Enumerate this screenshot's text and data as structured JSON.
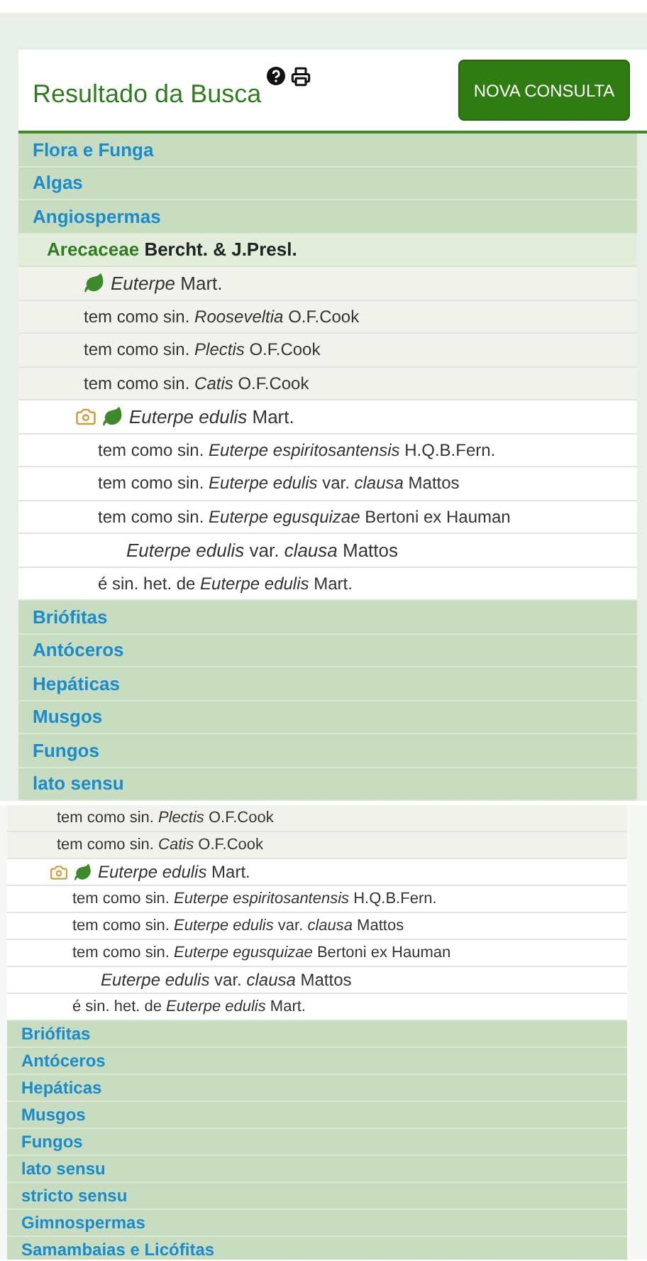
{
  "header": {
    "title": "Resultado da Busca",
    "button": "NOVA CONSULTA"
  },
  "panels": [
    {
      "rows": [
        {
          "kind": "group",
          "text": "Flora e Funga"
        },
        {
          "kind": "group",
          "text": "Algas"
        },
        {
          "kind": "group",
          "text": "Angiospermas"
        },
        {
          "kind": "family",
          "name": "Arecaceae",
          "author": "Bercht. & J.Presl."
        },
        {
          "kind": "genus",
          "text": "*Euterpe* Mart."
        },
        {
          "kind": "genus-synonym",
          "text": "tem como sin. *Rooseveltia* O.F.Cook"
        },
        {
          "kind": "genus-synonym",
          "text": "tem como sin. *Plectis* O.F.Cook"
        },
        {
          "kind": "genus-synonym",
          "text": "tem como sin. *Catis* O.F.Cook"
        },
        {
          "kind": "species",
          "text": "*Euterpe edulis* Mart."
        },
        {
          "kind": "species-synonym",
          "text": "tem como sin. *Euterpe espiritosantensis* H.Q.B.Fern."
        },
        {
          "kind": "species-synonym",
          "text": "tem como sin. *Euterpe edulis* var. *clausa* Mattos"
        },
        {
          "kind": "species-synonym",
          "text": "tem como sin. *Euterpe egusquizae* Bertoni ex Hauman"
        },
        {
          "kind": "variety",
          "text": "*Euterpe edulis* var. *clausa* Mattos"
        },
        {
          "kind": "heterotypic",
          "text": "é sin. het. de *Euterpe edulis* Mart."
        },
        {
          "kind": "group",
          "text": "Briófitas"
        },
        {
          "kind": "group",
          "text": "Antóceros"
        },
        {
          "kind": "group",
          "text": "Hepáticas"
        },
        {
          "kind": "group",
          "text": "Musgos"
        },
        {
          "kind": "group",
          "text": "Fungos"
        },
        {
          "kind": "group",
          "text": "lato sensu"
        }
      ]
    },
    {
      "rows": [
        {
          "kind": "genus-synonym",
          "text": "tem como sin. *Plectis* O.F.Cook"
        },
        {
          "kind": "genus-synonym",
          "text": "tem como sin. *Catis* O.F.Cook"
        },
        {
          "kind": "species",
          "text": "*Euterpe edulis* Mart."
        },
        {
          "kind": "species-synonym",
          "text": "tem como sin. *Euterpe espiritosantensis* H.Q.B.Fern."
        },
        {
          "kind": "species-synonym",
          "text": "tem como sin. *Euterpe edulis* var. *clausa* Mattos"
        },
        {
          "kind": "species-synonym",
          "text": "tem como sin. *Euterpe egusquizae* Bertoni ex Hauman"
        },
        {
          "kind": "variety",
          "text": "*Euterpe edulis* var. *clausa* Mattos"
        },
        {
          "kind": "heterotypic",
          "text": "é sin. het. de *Euterpe edulis* Mart."
        },
        {
          "kind": "group",
          "text": "Briófitas"
        },
        {
          "kind": "group",
          "text": "Antóceros"
        },
        {
          "kind": "group",
          "text": "Hepáticas"
        },
        {
          "kind": "group",
          "text": "Musgos"
        },
        {
          "kind": "group",
          "text": "Fungos"
        },
        {
          "kind": "group",
          "text": "lato sensu"
        },
        {
          "kind": "group",
          "text": "stricto sensu"
        },
        {
          "kind": "group",
          "text": "Gimnospermas"
        },
        {
          "kind": "group",
          "text": "Samambaias e Licófitas"
        }
      ]
    }
  ]
}
